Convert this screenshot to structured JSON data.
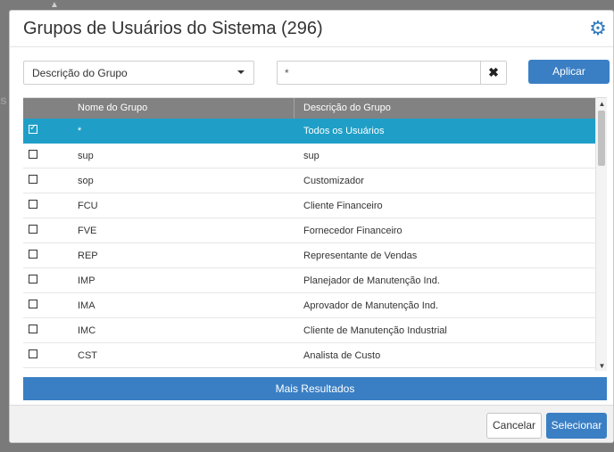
{
  "modal": {
    "title": "Grupos de Usuários do Sistema (296)",
    "settings_icon": "gear-icon"
  },
  "filter": {
    "field_selected": "Descrição do Grupo",
    "search_value": "*",
    "clear_icon": "close-icon",
    "apply_label": "Aplicar"
  },
  "table": {
    "columns": [
      "Nome do Grupo",
      "Descrição do Grupo"
    ],
    "rows": [
      {
        "name": "*",
        "description": "Todos os Usuários",
        "checked": true
      },
      {
        "name": "sup",
        "description": "sup",
        "checked": false
      },
      {
        "name": "sop",
        "description": "Customizador",
        "checked": false
      },
      {
        "name": "FCU",
        "description": "Cliente Financeiro",
        "checked": false
      },
      {
        "name": "FVE",
        "description": "Fornecedor Financeiro",
        "checked": false
      },
      {
        "name": "REP",
        "description": "Representante de Vendas",
        "checked": false
      },
      {
        "name": "IMP",
        "description": "Planejador de Manutenção Ind.",
        "checked": false
      },
      {
        "name": "IMA",
        "description": "Aprovador de Manutenção Ind.",
        "checked": false
      },
      {
        "name": "IMC",
        "description": "Cliente de Manutenção Industrial",
        "checked": false
      },
      {
        "name": "CST",
        "description": "Analista de Custo",
        "checked": false
      }
    ]
  },
  "more_results_label": "Mais Resultados",
  "footer": {
    "cancel_label": "Cancelar",
    "select_label": "Selecionar"
  },
  "colors": {
    "accent": "#3a7fc4",
    "selected_row": "#1f9fc7",
    "header_bg": "#828282"
  }
}
